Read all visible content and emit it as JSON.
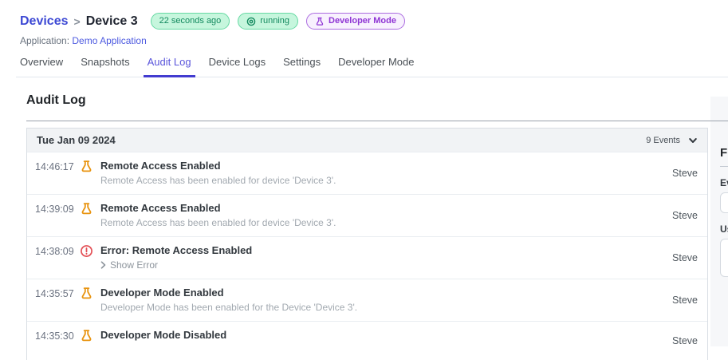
{
  "colors": {
    "accent_indigo": "#4943d6",
    "link_blue": "#4d5ae0",
    "badge_green_bg": "#c6f6dd",
    "badge_green_border": "#66d9a3",
    "badge_green_text": "#148a5f",
    "badge_purple_border": "#ab6be0",
    "badge_purple_text": "#8f35d4",
    "flask_orange": "#e8930e",
    "error_red": "#e34f55"
  },
  "breadcrumb": {
    "parent": "Devices",
    "separator": ">",
    "current": "Device 3"
  },
  "status_badges": {
    "last_seen": "22 seconds ago",
    "state": "running",
    "mode": "Developer Mode"
  },
  "application": {
    "label": "Application:",
    "name": "Demo Application"
  },
  "tabs": [
    {
      "label": "Overview"
    },
    {
      "label": "Snapshots"
    },
    {
      "label": "Audit Log",
      "active": true
    },
    {
      "label": "Device Logs"
    },
    {
      "label": "Settings"
    },
    {
      "label": "Developer Mode"
    }
  ],
  "audit_log": {
    "title": "Audit Log",
    "day_group": {
      "date": "Tue Jan 09 2024",
      "events_count": "9 Events"
    },
    "rows": [
      {
        "time": "14:46:17",
        "icon": "flask",
        "title": "Remote Access Enabled",
        "description": "Remote Access has been enabled for device 'Device 3'.",
        "user": "Steve"
      },
      {
        "time": "14:39:09",
        "icon": "flask",
        "title": "Remote Access Enabled",
        "description": "Remote Access has been enabled for device 'Device 3'.",
        "user": "Steve"
      },
      {
        "time": "14:38:09",
        "icon": "error",
        "title": "Error: Remote Access Enabled",
        "show_error_label": "Show Error",
        "user": "Steve"
      },
      {
        "time": "14:35:57",
        "icon": "flask",
        "title": "Developer Mode Enabled",
        "description": "Developer Mode has been enabled for the Device 'Device 3'.",
        "user": "Steve"
      },
      {
        "time": "14:35:30",
        "icon": "flask",
        "title": "Developer Mode Disabled",
        "user": "Steve"
      }
    ]
  },
  "filter_panel": {
    "title": "Filter",
    "events_label": "Events",
    "users_label": "Users"
  }
}
